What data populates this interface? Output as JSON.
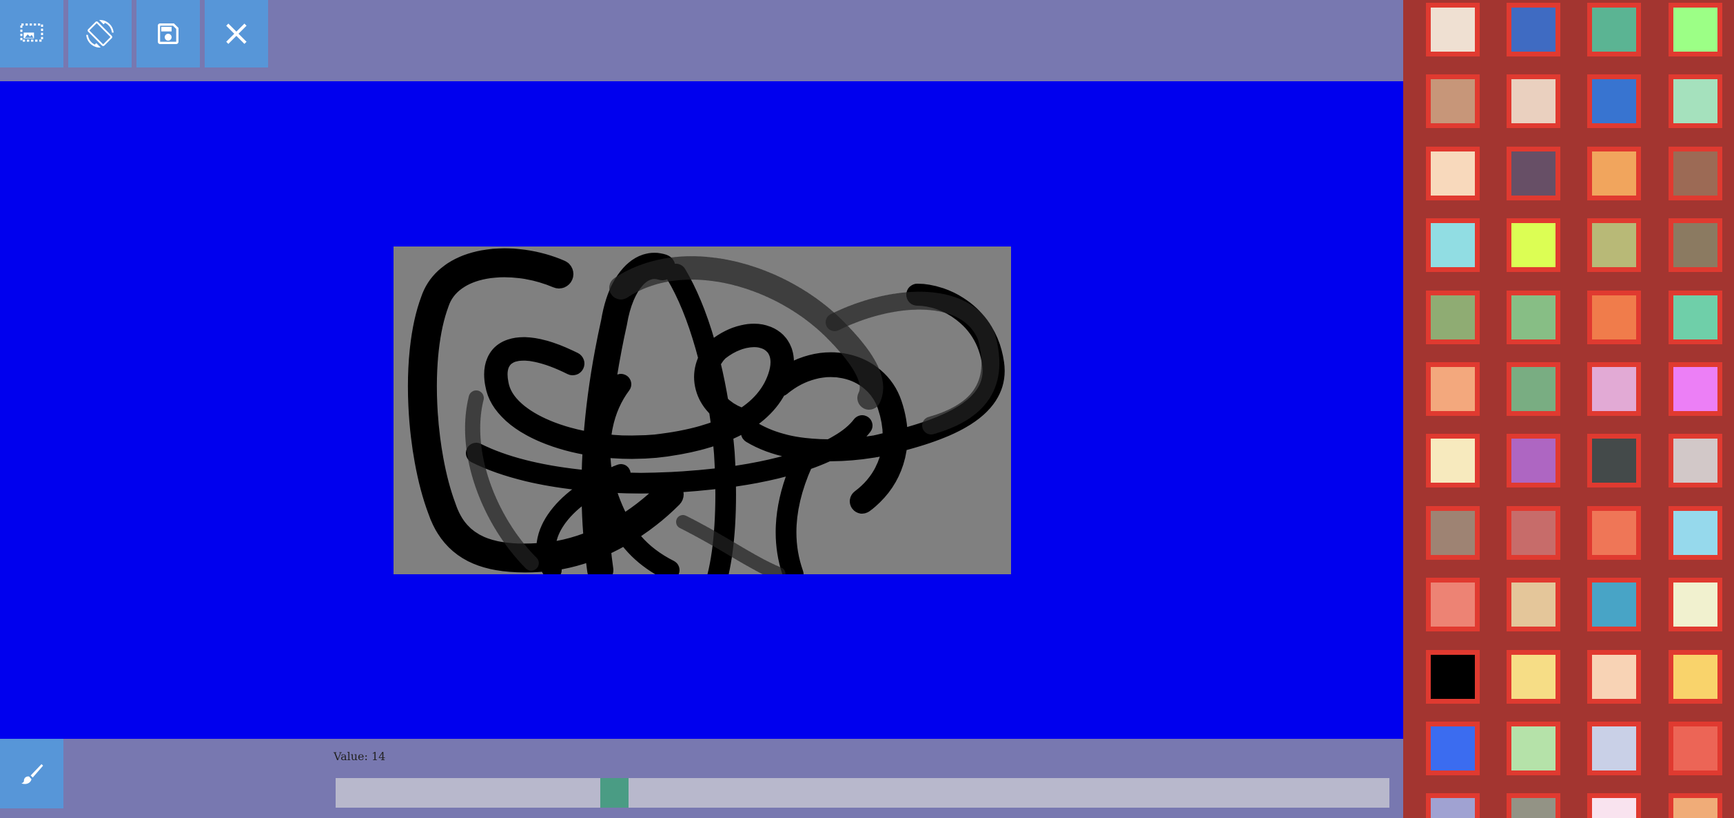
{
  "toolbar": {
    "buttons": [
      {
        "name": "crop-image-button",
        "icon": "crop-image-icon"
      },
      {
        "name": "rotate-screen-button",
        "icon": "screen-rotation-icon"
      },
      {
        "name": "save-button",
        "icon": "floppy-disk-icon"
      },
      {
        "name": "close-button",
        "icon": "close-icon"
      }
    ]
  },
  "colors": {
    "toolbar_bg": "#7878b0",
    "button_bg": "#5796d8",
    "canvas_bg": "#0000ee",
    "drawing_bg": "#808080",
    "palette_bg": "#a33530",
    "swatch_border": "#e03a30",
    "slider_track": "#b8b8cc",
    "slider_thumb": "#4a9c84"
  },
  "brush": {
    "icon": "paintbrush-icon",
    "value_label": "Value: 14",
    "slider_fraction": 0.258
  },
  "palette": {
    "rows": [
      [
        "#efe0d2",
        "#3f6bc2",
        "#5bb493",
        "#9cff86"
      ],
      [
        "#c79679",
        "#ead0bf",
        "#3874d0",
        "#a5e1bd"
      ],
      [
        "#f8d9bc",
        "#674f66",
        "#f1a55d",
        "#9c6a55"
      ],
      [
        "#91dde3",
        "#dcfe54",
        "#b8b977",
        "#8b7a61"
      ],
      [
        "#8fac73",
        "#87be85",
        "#f07c4b",
        "#6fcfa9"
      ],
      [
        "#f3a87d",
        "#79ad82",
        "#e2aad5",
        "#ec7ff6"
      ],
      [
        "#f7eabe",
        "#ae66c2",
        "#444a4a",
        "#d2c8c8"
      ],
      [
        "#9e8373",
        "#c76c6a",
        "#ef7657",
        "#96d9ec"
      ],
      [
        "#ed8374",
        "#e4c69a",
        "#48a4c6",
        "#f1f1cf"
      ],
      [
        "#000000",
        "#f6dd86",
        "#f8d3b5",
        "#f9d36b"
      ],
      [
        "#3b6cf0",
        "#b5e2a9",
        "#c9d0e7",
        "#ec6556"
      ],
      [
        "#a0a2d2",
        "#939385",
        "#f9e3ef",
        "#f0ac78"
      ]
    ]
  }
}
